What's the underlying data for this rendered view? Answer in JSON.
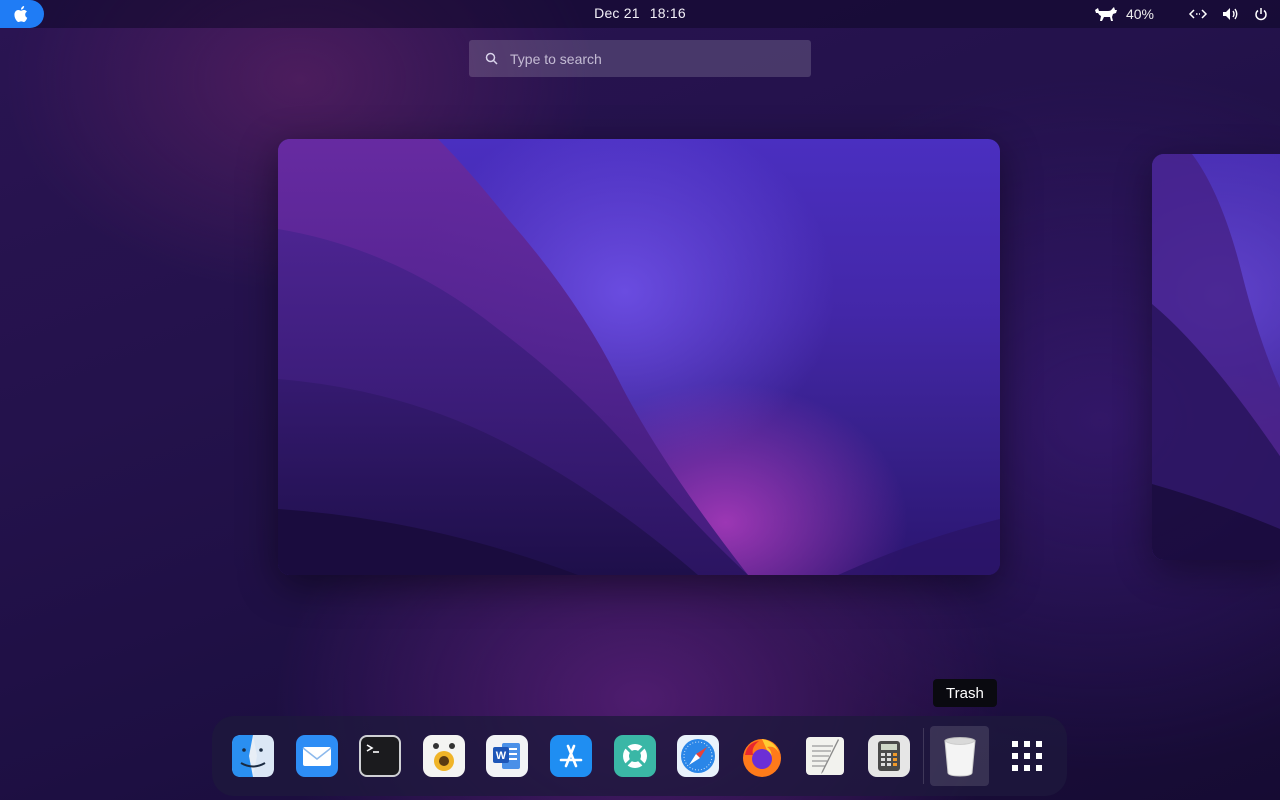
{
  "topbar": {
    "date": "Dec 21",
    "time": "18:16",
    "battery_percent": "40%"
  },
  "search": {
    "placeholder": "Type to search"
  },
  "dock": {
    "apps": [
      {
        "name": "Finder",
        "icon": "finder-icon"
      },
      {
        "name": "Mail",
        "icon": "mail-icon"
      },
      {
        "name": "Terminal",
        "icon": "terminal-icon"
      },
      {
        "name": "Rhythmbox",
        "icon": "speaker-icon"
      },
      {
        "name": "Word",
        "icon": "word-icon"
      },
      {
        "name": "App Store",
        "icon": "app-store-icon"
      },
      {
        "name": "Help",
        "icon": "lifebuoy-icon"
      },
      {
        "name": "Safari",
        "icon": "safari-icon"
      },
      {
        "name": "Firefox",
        "icon": "firefox-icon"
      },
      {
        "name": "TextEdit",
        "icon": "text-editor-icon"
      },
      {
        "name": "Calculator",
        "icon": "calculator-icon"
      }
    ],
    "trash": "Trash",
    "tooltip": "Trash"
  },
  "colors": {
    "accent": "#1f7cf5",
    "dock_bg": "#1e183c"
  }
}
